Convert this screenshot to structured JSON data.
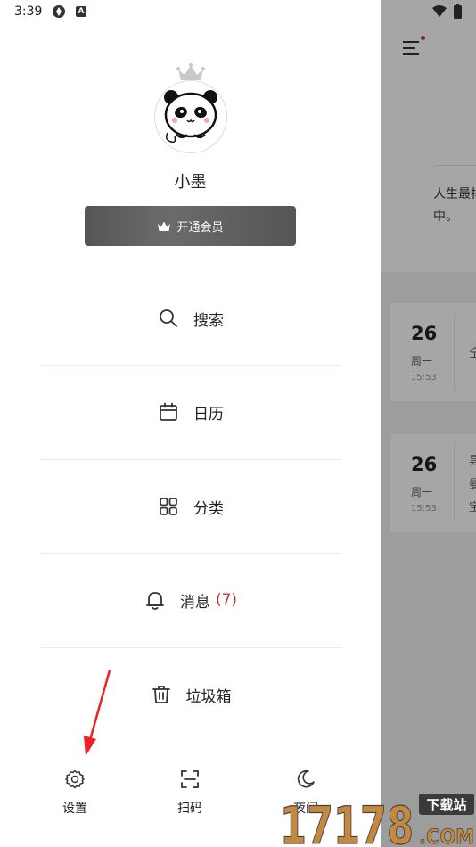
{
  "status_bar": {
    "time": "3:39",
    "app_badge": "A"
  },
  "profile": {
    "username": "小墨",
    "vip_button_label": "开通会员"
  },
  "menu": {
    "items": [
      {
        "icon": "search-icon",
        "label": "搜索"
      },
      {
        "icon": "calendar-icon",
        "label": "日历"
      },
      {
        "icon": "category-grid-icon",
        "label": "分类"
      },
      {
        "icon": "bell-icon",
        "label": "消息",
        "count": "(7)"
      },
      {
        "icon": "trash-icon",
        "label": "垃圾箱"
      }
    ]
  },
  "bottom_bar": {
    "settings_label": "设置",
    "scan_label": "扫码",
    "night_label": "夜间"
  },
  "background": {
    "preview_text_line1": "人生最抖",
    "preview_text_line2": "中。",
    "cards": [
      {
        "day": "26",
        "weekday": "周一",
        "time": "15:53",
        "fragment": "仝"
      },
      {
        "day": "26",
        "weekday": "周一",
        "time": "15:53",
        "fragment": "昙\n曼\n宝"
      }
    ]
  },
  "watermark": {
    "text_top": "下载站",
    "text_bottom": "17178.COM"
  },
  "colors": {
    "accent_red": "#c0392b",
    "vip_gray": "#5a5a5a",
    "overlay": "rgba(0,0,0,0.35)"
  }
}
